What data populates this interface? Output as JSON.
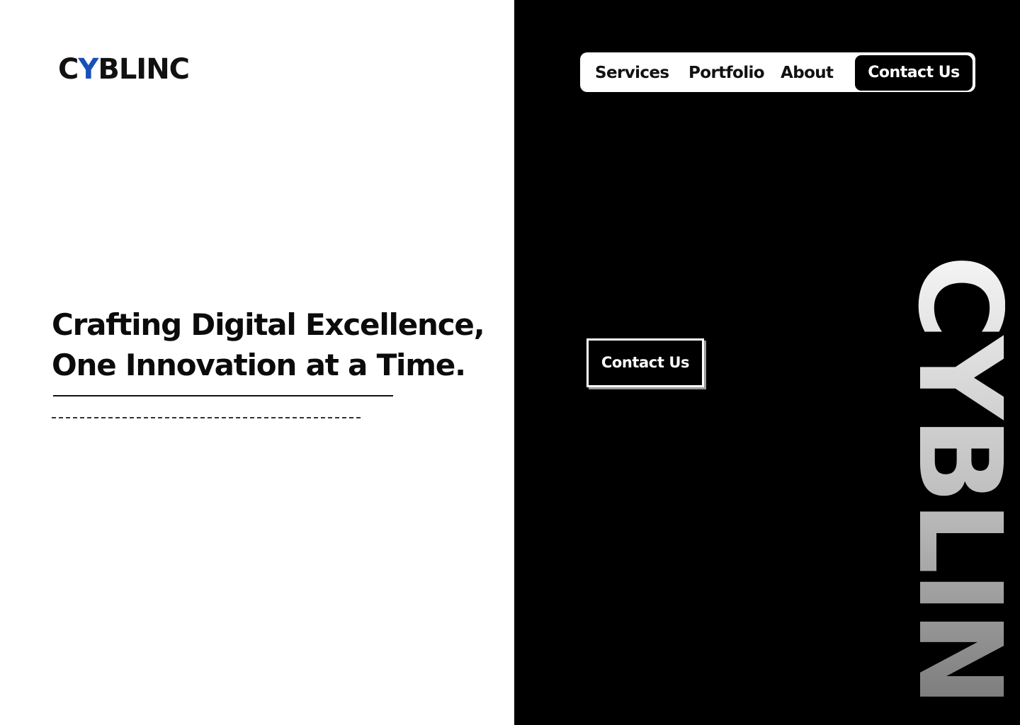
{
  "brand": {
    "logo_prefix": "C",
    "logo_accent": "Y",
    "logo_suffix": "BLINC",
    "accent_color": "#1650b8",
    "vertical_wordmark": "CYBLINC"
  },
  "hero": {
    "headline_line1": "Crafting Digital Excellence,",
    "headline_line2": "One Innovation at a Time."
  },
  "nav": {
    "items": [
      {
        "label": "Services"
      },
      {
        "label": "Portfolio"
      },
      {
        "label": "About"
      }
    ],
    "contact_label": "Contact Us"
  },
  "cta": {
    "label": "Contact Us"
  },
  "colors": {
    "left_background": "#ffffff",
    "right_background": "#000000",
    "text_dark": "#111111"
  }
}
